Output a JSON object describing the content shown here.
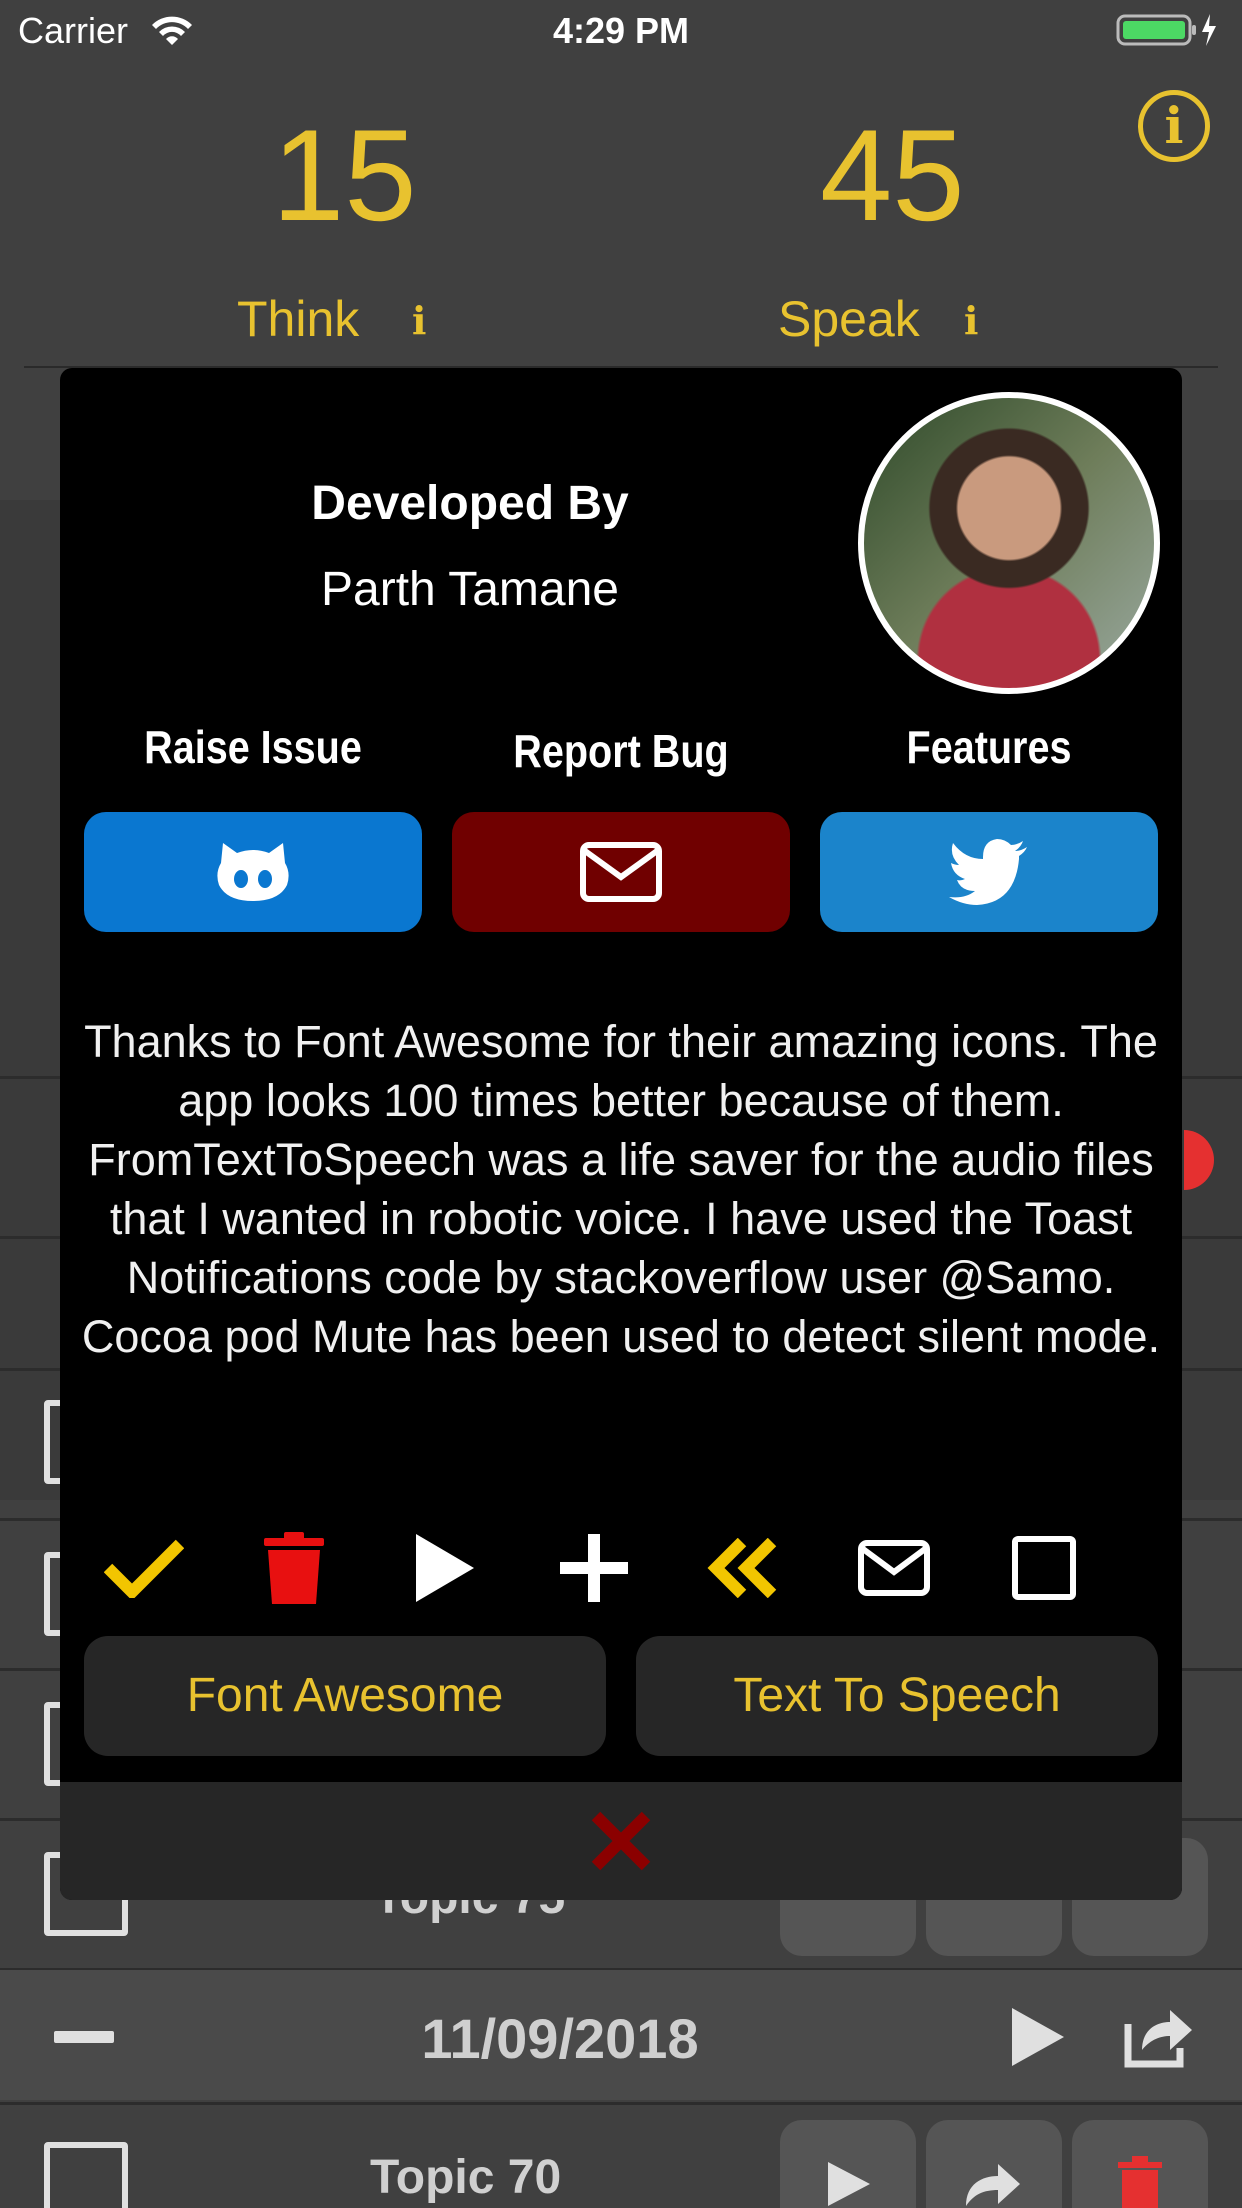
{
  "status_bar": {
    "carrier": "Carrier",
    "time": "4:29 PM"
  },
  "header": {
    "think_value": "15",
    "speak_value": "45",
    "think_label": "Think",
    "speak_label": "Speak",
    "info_glyph": "i"
  },
  "background_list": {
    "date": "11/09/2018",
    "topics": [
      "Topic 75",
      "Topic 70"
    ]
  },
  "about_modal": {
    "developed_by_label": "Developed By",
    "developer_name": "Parth Tamane",
    "links": [
      {
        "label": "Raise Issue",
        "icon": "github-icon",
        "color": "#0a77d0"
      },
      {
        "label": "Report Bug",
        "icon": "envelope-icon",
        "color": "#700000"
      },
      {
        "label": "Features",
        "icon": "twitter-icon",
        "color": "#1b84cb"
      }
    ],
    "credits_text": "Thanks to Font Awesome for their amazing icons. The app looks 100 times better because of them. FromTextToSpeech was a life saver for the audio files that I wanted in robotic voice. I have used the Toast Notifications code by stackoverflow user @Samo. Cocoa pod Mute has been used to detect silent mode.",
    "icon_row": [
      "check-icon",
      "trash-icon",
      "play-icon",
      "plus-icon",
      "double-chevron-left-icon",
      "envelope-icon",
      "square-icon"
    ],
    "font_awesome_label": "Font Awesome",
    "text_to_speech_label": "Text To Speech",
    "accent_color": "#e8c22f",
    "close_color": "#8b0000"
  }
}
